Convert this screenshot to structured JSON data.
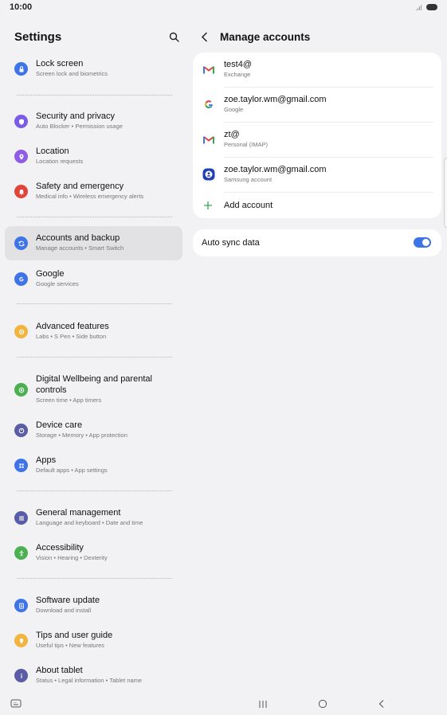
{
  "status_bar": {
    "time": "10:00"
  },
  "left": {
    "title": "Settings",
    "items": [
      {
        "title": "Lock screen",
        "sub": "Screen lock and biometrics",
        "icon": "lock-icon",
        "color": "#3e74e6"
      },
      {
        "title": "Security and privacy",
        "sub": "Auto Blocker  •  Permission usage",
        "icon": "shield-icon",
        "color": "#7b5ce6"
      },
      {
        "title": "Location",
        "sub": "Location requests",
        "icon": "location-pin-icon",
        "color": "#8e5ce6"
      },
      {
        "title": "Safety and emergency",
        "sub": "Medical info  •  Wireless emergency alerts",
        "icon": "bell-icon",
        "color": "#e0453a"
      },
      {
        "title": "Accounts and backup",
        "sub": "Manage accounts  •  Smart Switch",
        "icon": "sync-icon",
        "color": "#3e74e6"
      },
      {
        "title": "Google",
        "sub": "Google services",
        "icon": "google-g-icon",
        "color": "#3e74e6"
      },
      {
        "title": "Advanced features",
        "sub": "Labs  •  S Pen  •  Side button",
        "icon": "gear-plus-icon",
        "color": "#f1b43e"
      },
      {
        "title": "Digital Wellbeing and parental controls",
        "sub": "Screen time  •  App timers",
        "icon": "wellbeing-icon",
        "color": "#4caf50"
      },
      {
        "title": "Device care",
        "sub": "Storage  •  Memory  •  App protection",
        "icon": "device-care-icon",
        "color": "#5b5ca6"
      },
      {
        "title": "Apps",
        "sub": "Default apps  •  App settings",
        "icon": "apps-grid-icon",
        "color": "#3e74e6"
      },
      {
        "title": "General management",
        "sub": "Language and keyboard  •  Date and time",
        "icon": "sliders-icon",
        "color": "#5b5ca6"
      },
      {
        "title": "Accessibility",
        "sub": "Vision  •  Hearing  •  Dexterity",
        "icon": "accessibility-icon",
        "color": "#4caf50"
      },
      {
        "title": "Software update",
        "sub": "Download and install",
        "icon": "software-update-icon",
        "color": "#3e74e6"
      },
      {
        "title": "Tips and user guide",
        "sub": "Useful tips  •  New features",
        "icon": "lightbulb-icon",
        "color": "#f1b43e"
      },
      {
        "title": "About tablet",
        "sub": "Status  •  Legal information  •  Tablet name",
        "icon": "info-icon",
        "color": "#5b5ca6"
      }
    ]
  },
  "right": {
    "title": "Manage accounts",
    "accounts": [
      {
        "name": "test4@",
        "type": "Exchange",
        "icon": "gmail-icon"
      },
      {
        "name": "zoe.taylor.wm@gmail.com",
        "type": "Google",
        "icon": "google-g-icon"
      },
      {
        "name": "zt@",
        "type": "Personal (IMAP)",
        "icon": "gmail-icon"
      },
      {
        "name": "zoe.taylor.wm@gmail.com",
        "type": "Samsung account",
        "icon": "samsung-account-icon"
      }
    ],
    "add_account": "Add account",
    "auto_sync": {
      "label": "Auto sync data",
      "on": true
    }
  }
}
